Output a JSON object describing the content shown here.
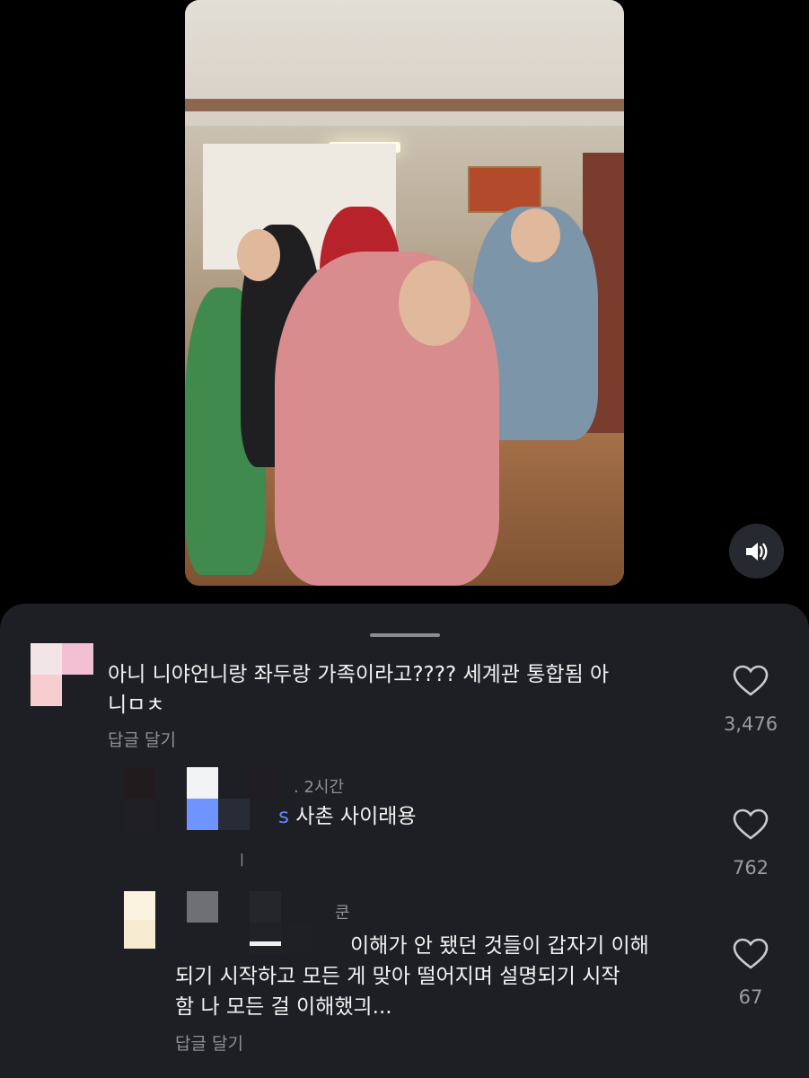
{
  "video": {
    "mute_icon": "speaker-icon"
  },
  "comments": [
    {
      "text_line1": "아니 니야언니랑 좌두랑 가족이라고???? 세계관 통합됨 아",
      "text_line2": "니ㅁㅊ",
      "reply_label": "답글 달기",
      "likes": "3,476"
    },
    {
      "time": "2시간",
      "mention_fragment": "s",
      "text": "사촌 사이래용",
      "likes": "762",
      "stray": "ㅣ"
    },
    {
      "time_fragment": "쿤",
      "text_line1": "이해가 안 됐던 것들이 갑자기 이해",
      "text_line2": "되기 시작하고 모든 게 맞아 떨어지며 설명되기 시작",
      "text_line3": "함 나 모든 걸 이해했긔...",
      "reply_label": "답글 달기",
      "likes": "67"
    }
  ],
  "colors": {
    "sheet_bg": "#1d1f24",
    "text": "#f2f2f2",
    "muted": "#8d9096",
    "mention": "#5b8cff"
  }
}
